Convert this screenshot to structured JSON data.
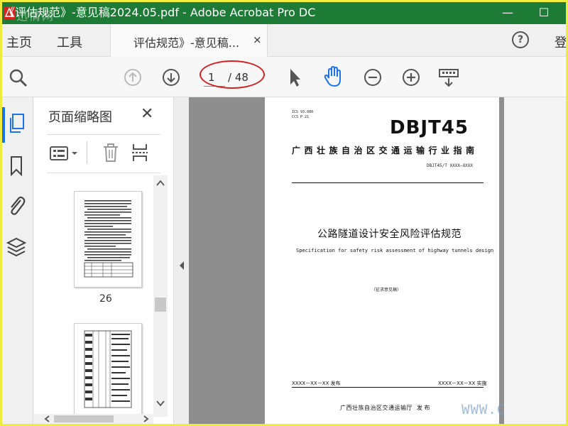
{
  "window": {
    "title": "《评估规范》-意见稿2024.05.pdf - Adobe Acrobat Pro DC",
    "minimize": "—",
    "maximize": "☐",
    "watermark": "迅情网"
  },
  "tabs": {
    "home": "主页",
    "tools": "工具",
    "doc_tab": "评估规范》-意见稿...",
    "close": "×",
    "help": "?",
    "login": "登"
  },
  "toolbar": {
    "current_page": "1",
    "total_pages": "/ 48",
    "icons": [
      "search-icon",
      "page-up-icon",
      "page-down-icon",
      "select-cursor-icon",
      "hand-tool-icon",
      "zoom-out-icon",
      "zoom-in-icon",
      "keyboard-download-icon"
    ]
  },
  "accent": "#1a73e8",
  "annotation_color": "#d42020",
  "thumbnail_panel": {
    "title": "页面缩略图",
    "close": "✕",
    "thumbnails": [
      {
        "label": "26"
      },
      {
        "label": ""
      }
    ]
  },
  "document": {
    "ics": "ICS 93.080",
    "ccs": "CCS P 21",
    "brand": "DBJT45",
    "org": "广西壮族自治区交通运输行业指南",
    "code": "DBJT45/T XXXX—XXXX",
    "title": "公路隧道设计安全风险评估规范",
    "title_en": "Specification for safety risk assessment of highway tunnels design",
    "draft": "（征求意见稿）",
    "issue_date": "XXXX－XX－XX 发布",
    "impl_date": "XXXX－XX－XX 实施",
    "publisher": "广西壮族自治区交通运输厅",
    "publish_word": "发  布"
  },
  "watermark_br": "WWW.C"
}
